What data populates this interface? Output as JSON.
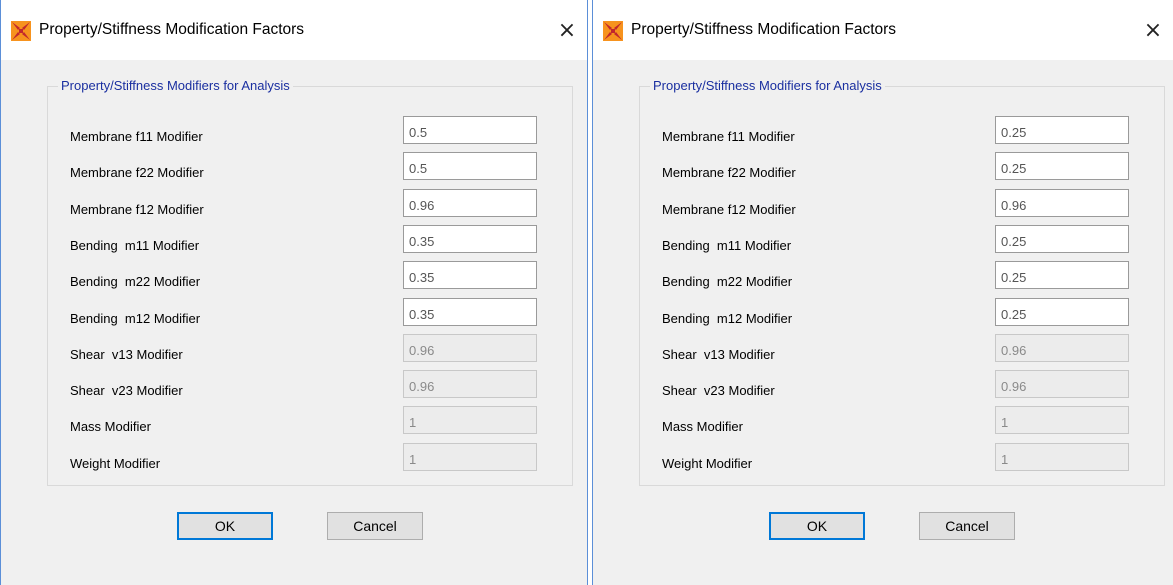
{
  "dialogs": [
    {
      "title": "Property/Stiffness Modification Factors",
      "close_glyph": "×",
      "group_title": "Property/Stiffness Modifiers for Analysis",
      "rows": [
        {
          "label": "Membrane f11 Modifier",
          "value": "0.5",
          "enabled": true
        },
        {
          "label": "Membrane f22 Modifier",
          "value": "0.5",
          "enabled": true
        },
        {
          "label": "Membrane f12 Modifier",
          "value": "0.96",
          "enabled": true
        },
        {
          "label": "Bending  m11 Modifier",
          "value": "0.35",
          "enabled": true
        },
        {
          "label": "Bending  m22 Modifier",
          "value": "0.35",
          "enabled": true
        },
        {
          "label": "Bending  m12 Modifier",
          "value": "0.35",
          "enabled": true
        },
        {
          "label": "Shear  v13 Modifier",
          "value": "0.96",
          "enabled": false
        },
        {
          "label": "Shear  v23 Modifier",
          "value": "0.96",
          "enabled": false
        },
        {
          "label": "Mass Modifier",
          "value": "1",
          "enabled": false
        },
        {
          "label": "Weight Modifier",
          "value": "1",
          "enabled": false
        }
      ],
      "ok_label": "OK",
      "cancel_label": "Cancel"
    },
    {
      "title": "Property/Stiffness Modification Factors",
      "close_glyph": "×",
      "group_title": "Property/Stiffness Modifiers for Analysis",
      "rows": [
        {
          "label": "Membrane f11 Modifier",
          "value": "0.25",
          "enabled": true
        },
        {
          "label": "Membrane f22 Modifier",
          "value": "0.25",
          "enabled": true
        },
        {
          "label": "Membrane f12 Modifier",
          "value": "0.96",
          "enabled": true
        },
        {
          "label": "Bending  m11 Modifier",
          "value": "0.25",
          "enabled": true
        },
        {
          "label": "Bending  m22 Modifier",
          "value": "0.25",
          "enabled": true
        },
        {
          "label": "Bending  m12 Modifier",
          "value": "0.25",
          "enabled": true
        },
        {
          "label": "Shear  v13 Modifier",
          "value": "0.96",
          "enabled": false
        },
        {
          "label": "Shear  v23 Modifier",
          "value": "0.96",
          "enabled": false
        },
        {
          "label": "Mass Modifier",
          "value": "1",
          "enabled": false
        },
        {
          "label": "Weight Modifier",
          "value": "1",
          "enabled": false
        }
      ],
      "ok_label": "OK",
      "cancel_label": "Cancel"
    }
  ],
  "icons": {
    "app": "sap-etabs-app-icon",
    "close": "close-icon"
  },
  "colors": {
    "window_border": "#5b8fd8",
    "dialog_bg": "#f0f0f0",
    "group_title": "#1a2fa0",
    "default_button_border": "#0078d7",
    "icon_orange": "#f7931e",
    "icon_red": "#c1272d"
  }
}
